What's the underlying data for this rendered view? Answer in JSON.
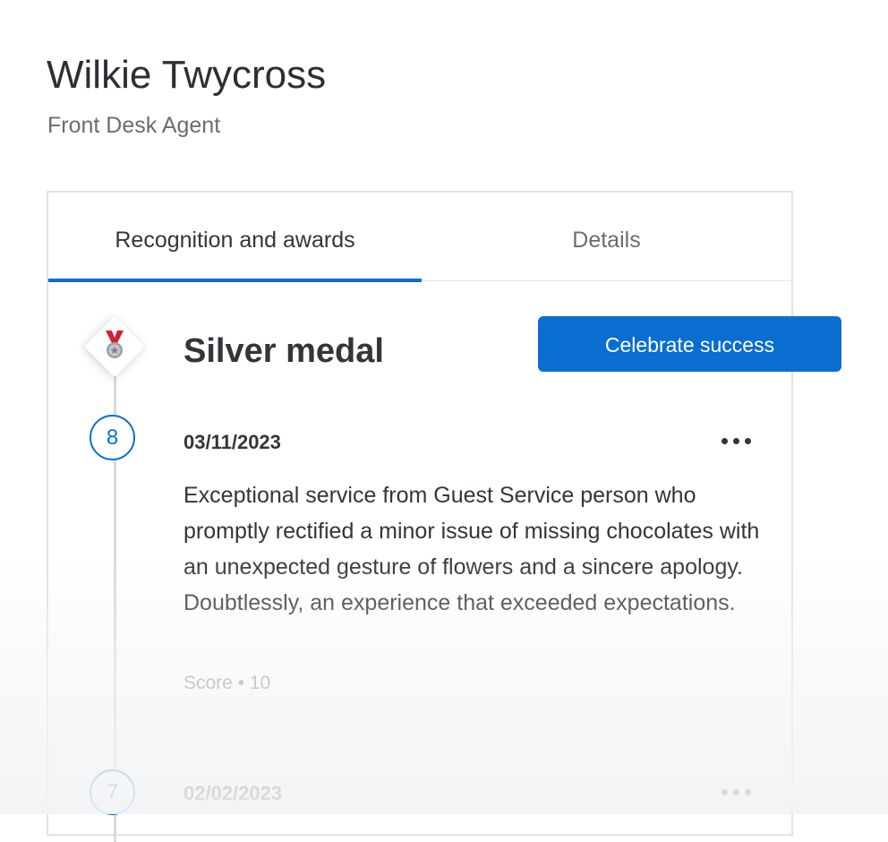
{
  "profile": {
    "name": "Wilkie Twycross",
    "job_title": "Front Desk Agent"
  },
  "tabs": [
    {
      "label": "Recognition and awards",
      "active": true
    },
    {
      "label": "Details",
      "active": false
    }
  ],
  "award": {
    "title": "Silver medal",
    "icon": "medal-icon",
    "celebrate_label": "Celebrate success"
  },
  "entries": [
    {
      "count": "8",
      "date": "03/11/2023",
      "text": "Exceptional service from Guest Service person who promptly rectified a minor issue of missing chocolates with an unexpected gesture of flowers and a sincere apology. Doubtlessly, an experience that exceeded expectations.",
      "score": "Score • 10"
    },
    {
      "count": "7",
      "date": "02/02/2023"
    }
  ],
  "colors": {
    "accent": "#0a6ed1",
    "text": "#32363a",
    "muted": "#6a6d70",
    "medal_ribbon": "#d32030",
    "medal_silver": "#9aa0a6"
  }
}
